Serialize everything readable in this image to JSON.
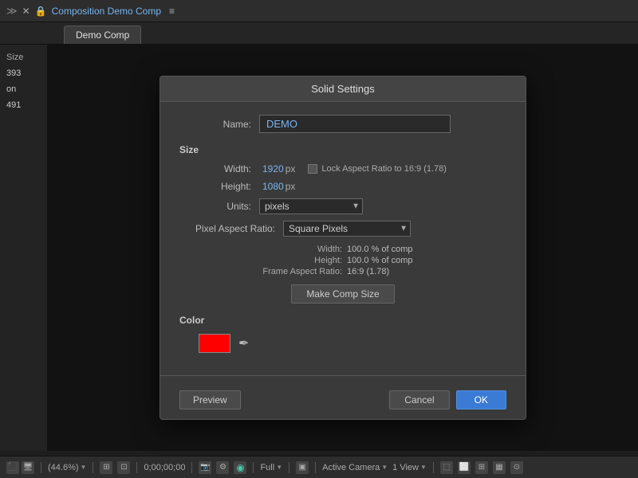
{
  "topbar": {
    "icons": "≫",
    "close": "✕",
    "title_prefix": "Composition ",
    "title_comp": "Demo Comp",
    "menu": "≡"
  },
  "tab": {
    "label": "Demo Comp"
  },
  "sidebar": {
    "label": "Size",
    "value1": "393",
    "label2": "on",
    "value2": "491"
  },
  "dialog": {
    "title": "Solid Settings",
    "name_label": "Name:",
    "name_value": "DEMO",
    "size_label": "Size",
    "width_label": "Width:",
    "width_value": "1920",
    "width_unit": "px",
    "height_label": "Height:",
    "height_value": "1080",
    "height_unit": "px",
    "lock_label": "Lock Aspect Ratio to 16:9 (1.78)",
    "units_label": "Units:",
    "units_value": "pixels",
    "par_label": "Pixel Aspect Ratio:",
    "par_value": "Square Pixels",
    "info_width_label": "Width:",
    "info_width_value": "100.0 % of comp",
    "info_height_label": "Height:",
    "info_height_value": "100.0 % of comp",
    "info_far_label": "Frame Aspect Ratio:",
    "info_far_value": "16:9 (1.78)",
    "make_comp_size": "Make Comp Size",
    "color_label": "Color",
    "color_hex": "#ff0000",
    "preview_label": "Preview",
    "cancel_label": "Cancel",
    "ok_label": "OK"
  },
  "statusbar": {
    "zoom": "(44.6%)",
    "timecode": "0;00;00;00",
    "quality": "Full",
    "view": "Active Camera",
    "view_option": "1 View"
  }
}
